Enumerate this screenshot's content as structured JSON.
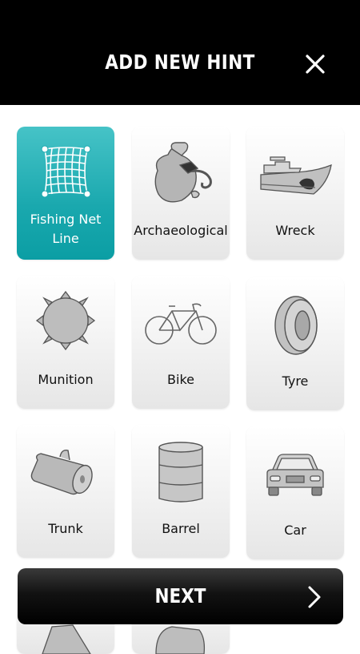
{
  "header": {
    "title": "ADD NEW HINT",
    "close_icon": "close-icon"
  },
  "categories": [
    {
      "label": "Fishing Net Line",
      "icon": "fishing-net-icon",
      "selected": true
    },
    {
      "label": "Archaeological",
      "icon": "amphora-icon",
      "selected": false
    },
    {
      "label": "Wreck",
      "icon": "ship-wreck-icon",
      "selected": false
    },
    {
      "label": "Munition",
      "icon": "sea-mine-icon",
      "selected": false
    },
    {
      "label": "Bike",
      "icon": "bicycle-icon",
      "selected": false
    },
    {
      "label": "Tyre",
      "icon": "tyre-icon",
      "selected": false
    },
    {
      "label": "Trunk",
      "icon": "tree-trunk-icon",
      "selected": false
    },
    {
      "label": "Barrel",
      "icon": "barrel-icon",
      "selected": false
    },
    {
      "label": "Car",
      "icon": "car-icon",
      "selected": false
    }
  ],
  "footer": {
    "next_label": "NEXT",
    "next_icon": "chevron-right-icon"
  },
  "colors": {
    "header_bg": "#000000",
    "selected_tile": "#1aa8ae",
    "tile_bg": "#f0f0f0"
  }
}
